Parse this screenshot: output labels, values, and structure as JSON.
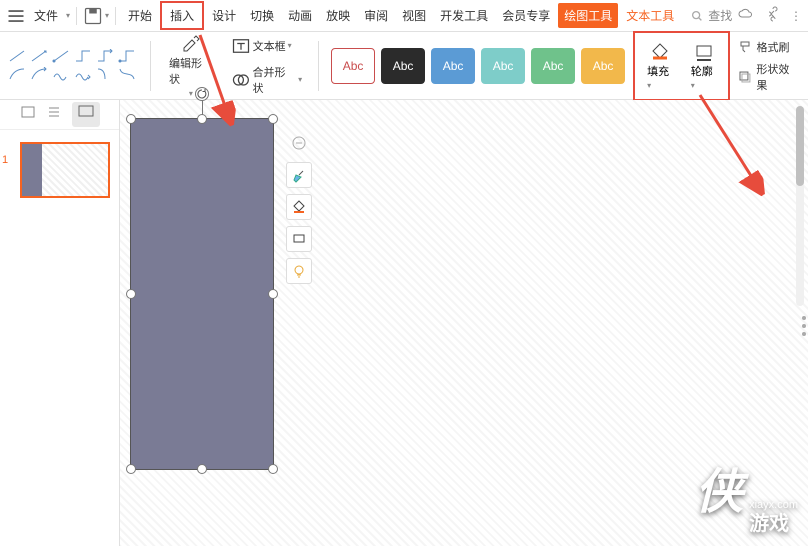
{
  "menubar": {
    "file": "文件",
    "tabs": [
      "开始",
      "插入",
      "设计",
      "切换",
      "动画",
      "放映",
      "审阅",
      "视图",
      "开发工具",
      "会员专享",
      "绘图工具",
      "文本工具"
    ],
    "search": "查找"
  },
  "toolbar": {
    "edit_shape": "编辑形状",
    "text_box": "文本框",
    "merge_shape": "合并形状",
    "abc": "Abc",
    "fill": "填充",
    "outline": "轮廓",
    "format_painter": "格式刷",
    "shape_effects": "形状效果"
  },
  "abc_styles": [
    {
      "bg": "#ffffff",
      "fg": "#c94d4d",
      "border": "#c94d4d"
    },
    {
      "bg": "#2b2b2b",
      "fg": "#ffffff",
      "border": "#2b2b2b"
    },
    {
      "bg": "#5b9bd5",
      "fg": "#ffffff",
      "border": "#5b9bd5"
    },
    {
      "bg": "#7ecdc9",
      "fg": "#ffffff",
      "border": "#7ecdc9"
    },
    {
      "bg": "#6fc28b",
      "fg": "#ffffff",
      "border": "#6fc28b"
    },
    {
      "bg": "#f2b84b",
      "fg": "#ffffff",
      "border": "#f2b84b"
    }
  ],
  "sidebar": {
    "slide_num": "1"
  },
  "watermark": {
    "big": "侠",
    "line1": "xiayx.com",
    "line2": "游戏"
  }
}
